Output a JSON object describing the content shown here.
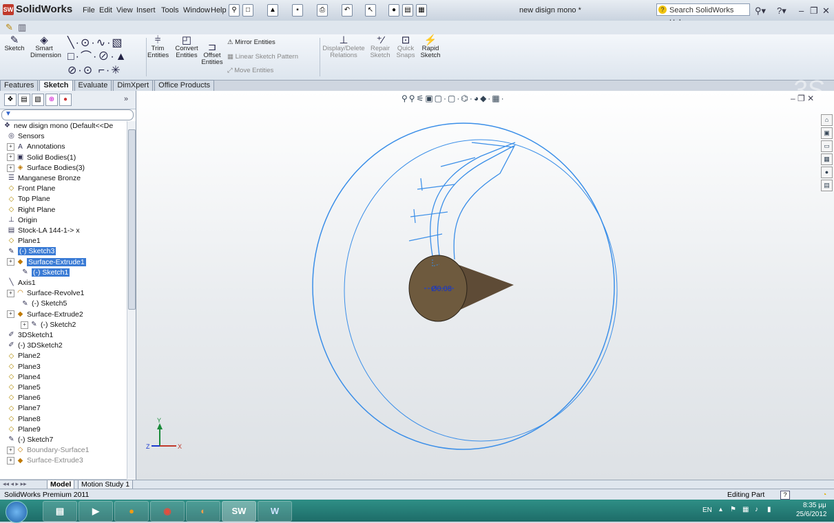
{
  "app": {
    "name": "SolidWorks",
    "doc_title": "new disign mono *"
  },
  "menu": [
    "File",
    "Edit",
    "View",
    "Insert",
    "Tools",
    "Window",
    "Help"
  ],
  "search": {
    "placeholder": "Search SolidWorks Help"
  },
  "toolbar": {
    "sketch": "Sketch",
    "smart_dimension": "Smart Dimension",
    "trim_entities": "Trim Entities",
    "convert_entities": "Convert Entities",
    "offset_entities": "Offset Entities",
    "mirror_entities": "Mirror Entities",
    "linear_sketch_pattern": "Linear Sketch Pattern",
    "move_entities": "Move Entities",
    "display_delete_relations": "Display/Delete Relations",
    "repair_sketch": "Repair Sketch",
    "quick_snaps": "Quick Snaps",
    "rapid_sketch": "Rapid Sketch"
  },
  "command_tabs": [
    "Features",
    "Sketch",
    "Evaluate",
    "DimXpert",
    "Office Products"
  ],
  "active_command_tab": "Sketch",
  "tree": [
    {
      "label": "new disign mono  (Default<<De",
      "icon": "part-icon",
      "level": 0
    },
    {
      "label": "Sensors",
      "icon": "sensor-icon",
      "level": 1
    },
    {
      "label": "Annotations",
      "icon": "annotation-icon",
      "level": 1,
      "expand": true
    },
    {
      "label": "Solid Bodies(1)",
      "icon": "solid-body-icon",
      "level": 1,
      "expand": true
    },
    {
      "label": "Surface Bodies(3)",
      "icon": "surface-body-icon",
      "level": 1,
      "expand": true
    },
    {
      "label": "Manganese Bronze",
      "icon": "material-icon",
      "level": 1
    },
    {
      "label": "Front Plane",
      "icon": "plane-icon",
      "level": 1
    },
    {
      "label": "Top Plane",
      "icon": "plane-icon",
      "level": 1
    },
    {
      "label": "Right Plane",
      "icon": "plane-icon",
      "level": 1
    },
    {
      "label": "Origin",
      "icon": "origin-icon",
      "level": 1
    },
    {
      "label": "Stock-LA 144-1-> x",
      "icon": "stock-icon",
      "level": 1
    },
    {
      "label": "Plane1",
      "icon": "plane-icon",
      "level": 1
    },
    {
      "label": "(-) Sketch3",
      "icon": "sketch-icon",
      "level": 1,
      "selected": true
    },
    {
      "label": "Surface-Extrude1",
      "icon": "surface-extrude-icon",
      "level": 1,
      "selected": true,
      "expand": true
    },
    {
      "label": "(-) Sketch1",
      "icon": "sketch-icon",
      "level": 2,
      "selected": true
    },
    {
      "label": "Axis1",
      "icon": "axis-icon",
      "level": 1
    },
    {
      "label": "Surface-Revolve1",
      "icon": "surface-revolve-icon",
      "level": 1,
      "expand": true
    },
    {
      "label": "(-) Sketch5",
      "icon": "sketch-icon",
      "level": 2
    },
    {
      "label": "Surface-Extrude2",
      "icon": "surface-extrude-icon",
      "level": 1,
      "expand": true
    },
    {
      "label": "(-) Sketch2",
      "icon": "sketch-icon",
      "level": 2,
      "expand": true
    },
    {
      "label": "3DSketch1",
      "icon": "3dsketch-icon",
      "level": 1
    },
    {
      "label": "(-) 3DSketch2",
      "icon": "3dsketch-icon",
      "level": 1
    },
    {
      "label": "Plane2",
      "icon": "plane-icon",
      "level": 1
    },
    {
      "label": "Plane3",
      "icon": "plane-icon",
      "level": 1
    },
    {
      "label": "Plane4",
      "icon": "plane-icon",
      "level": 1
    },
    {
      "label": "Plane5",
      "icon": "plane-icon",
      "level": 1
    },
    {
      "label": "Plane6",
      "icon": "plane-icon",
      "level": 1
    },
    {
      "label": "Plane7",
      "icon": "plane-icon",
      "level": 1
    },
    {
      "label": "Plane8",
      "icon": "plane-icon",
      "level": 1
    },
    {
      "label": "Plane9",
      "icon": "plane-icon",
      "level": 1
    },
    {
      "label": "(-) Sketch7",
      "icon": "sketch-icon",
      "level": 1
    },
    {
      "label": "Boundary-Surface1",
      "icon": "boundary-surface-icon",
      "level": 1,
      "dim": true,
      "expand": true
    },
    {
      "label": "Surface-Extrude3",
      "icon": "surface-extrude-icon",
      "level": 1,
      "dim": true,
      "expand": true
    }
  ],
  "model_tabs": [
    "Model",
    "Motion Study 1"
  ],
  "active_model_tab": "Model",
  "status": {
    "left": "SolidWorks Premium 2011",
    "mode": "Editing Part"
  },
  "viewport": {
    "dimension_label": "Ø0.08",
    "triad": {
      "y": "Y",
      "z": "Z",
      "x": "X"
    }
  },
  "taskbar": {
    "lang": "EN",
    "time": "8:35 μμ",
    "date": "25/6/2012"
  },
  "colors": {
    "sketch_blue": "#3a8ee8",
    "selection": "#3a7bd5",
    "body_brown": "#6e5a3e",
    "taskbar": "#1d6c68"
  }
}
